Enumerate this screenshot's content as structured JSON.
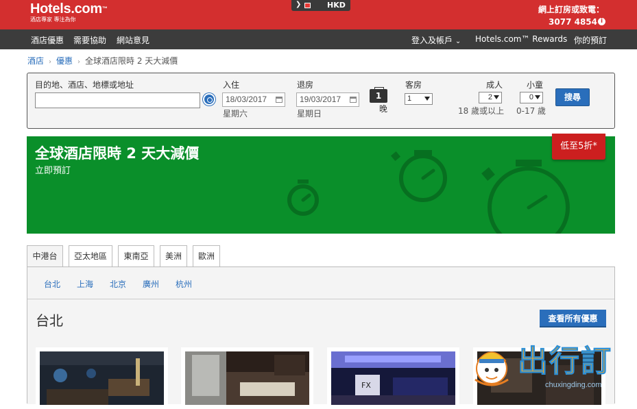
{
  "header": {
    "brand": "Hotels.com",
    "trademark": "™",
    "tagline": "酒店專家 專注為你",
    "currency_code": "HKD",
    "phone_label": "網上訂房或致電：",
    "phone_number": "3077 4854"
  },
  "nav": {
    "left": [
      "酒店優惠",
      "需要協助",
      "網站意見"
    ],
    "login": "登入及帳戶",
    "rewards": "Hotels.com™ Rewards",
    "bookings": "你的預訂"
  },
  "breadcrumb": {
    "items": [
      "酒店",
      "優惠"
    ],
    "current": "全球酒店限時 2 天大減價"
  },
  "search": {
    "destination_label": "目的地、酒店、地標或地址",
    "destination_value": "",
    "checkin_label": "入住",
    "checkin_value": "18/03/2017",
    "checkin_day": "星期六",
    "checkout_label": "退房",
    "checkout_value": "19/03/2017",
    "checkout_day": "星期日",
    "nights_count": "1",
    "nights_label": "晚",
    "rooms_label": "客房",
    "rooms_value": "1",
    "adults_label": "成人",
    "adults_value": "2",
    "adults_note": "18 歲或以上",
    "children_label": "小童",
    "children_value": "0",
    "children_note": "0-17 歲",
    "search_button": "搜尋"
  },
  "hero": {
    "title": "全球酒店限時 2 天大減價",
    "subtitle": "立即預訂",
    "badge": "低至5折*",
    "color": "#0a8f2a"
  },
  "region_tabs": [
    "中港台",
    "亞太地區",
    "東南亞",
    "美洲",
    "歐洲"
  ],
  "cities": [
    "台北",
    "上海",
    "北京",
    "廣州",
    "杭州"
  ],
  "section": {
    "city_title": "台北",
    "view_all": "查看所有優惠"
  },
  "watermark": {
    "text": "出行訂",
    "url": "chuxingding.com"
  },
  "colors": {
    "brand_red": "#d32f2f",
    "link_blue": "#2a6ebb",
    "nav_dark": "#3c3c3c"
  }
}
